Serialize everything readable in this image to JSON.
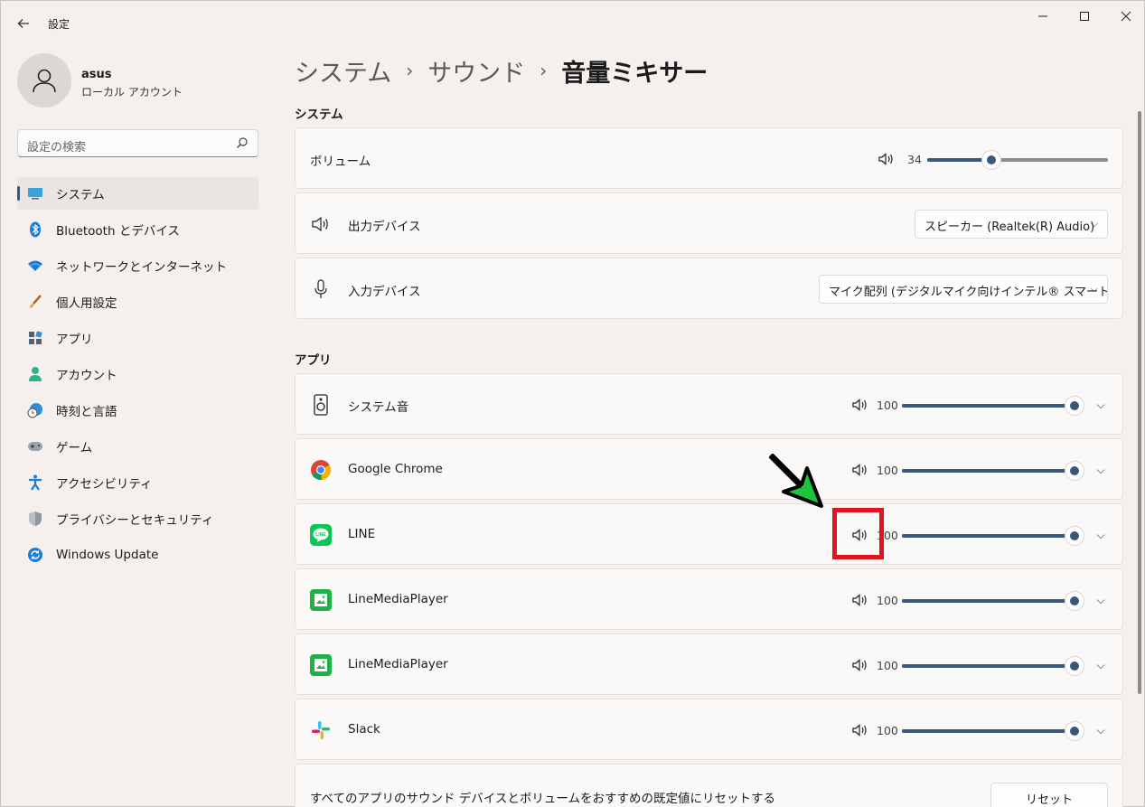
{
  "window": {
    "title": "設定"
  },
  "profile": {
    "name": "asus",
    "account_type": "ローカル アカウント"
  },
  "search": {
    "placeholder": "設定の検索"
  },
  "nav": [
    {
      "label": "システム",
      "icon": "monitor-icon",
      "active": true
    },
    {
      "label": "Bluetooth とデバイス",
      "icon": "bluetooth-icon"
    },
    {
      "label": "ネットワークとインターネット",
      "icon": "wifi-icon"
    },
    {
      "label": "個人用設定",
      "icon": "brush-icon"
    },
    {
      "label": "アプリ",
      "icon": "apps-icon"
    },
    {
      "label": "アカウント",
      "icon": "person-icon"
    },
    {
      "label": "時刻と言語",
      "icon": "clock-globe-icon"
    },
    {
      "label": "ゲーム",
      "icon": "gamepad-icon"
    },
    {
      "label": "アクセシビリティ",
      "icon": "accessibility-icon"
    },
    {
      "label": "プライバシーとセキュリティ",
      "icon": "shield-icon"
    },
    {
      "label": "Windows Update",
      "icon": "update-icon"
    }
  ],
  "breadcrumb": {
    "level1": "システム",
    "level2": "サウンド",
    "current": "音量ミキサー"
  },
  "system_section": {
    "title": "システム",
    "volume_label": "ボリューム",
    "volume_value": "34",
    "output_label": "出力デバイス",
    "output_value": "スピーカー (Realtek(R) Audio)",
    "input_label": "入力デバイス",
    "input_value": "マイク配列 (デジタルマイク向けインテル® スマート・"
  },
  "apps_section": {
    "title": "アプリ",
    "apps": [
      {
        "name": "システム音",
        "volume": "100",
        "icon": "system-sound-icon"
      },
      {
        "name": "Google Chrome",
        "volume": "100",
        "icon": "chrome-icon"
      },
      {
        "name": "LINE",
        "volume": "100",
        "icon": "line-icon"
      },
      {
        "name": "LineMediaPlayer",
        "volume": "100",
        "icon": "line-media-player-icon"
      },
      {
        "name": "LineMediaPlayer",
        "volume": "100",
        "icon": "line-media-player-icon"
      },
      {
        "name": "Slack",
        "volume": "100",
        "icon": "slack-icon"
      }
    ],
    "reset_label": "すべてのアプリのサウンド デバイスとボリュームをおすすめの既定値にリセットする",
    "reset_button": "リセット"
  },
  "colors": {
    "accent": "#3a587a",
    "highlight": "#e0141e",
    "arrow": "#1fc33a"
  }
}
